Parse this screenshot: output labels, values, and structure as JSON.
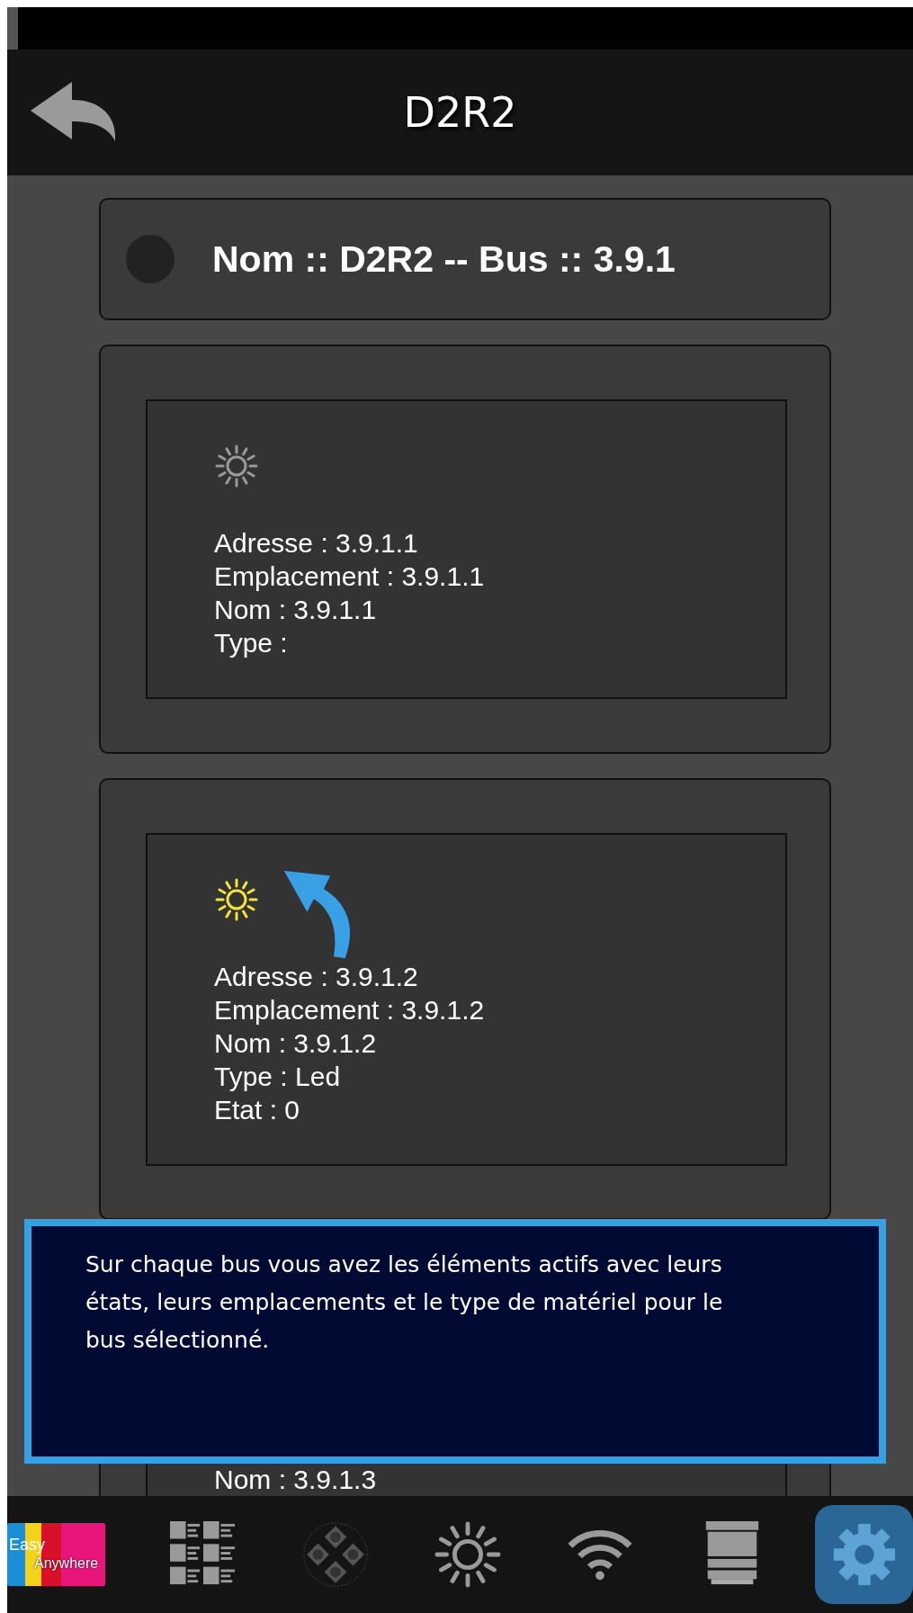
{
  "header": {
    "title": "D2R2"
  },
  "bus": {
    "label": "Nom :: D2R2 -- Bus :: 3.9.1"
  },
  "devices": [
    {
      "on": false,
      "lines": [
        "Adresse : 3.9.1.1",
        "Emplacement : 3.9.1.1",
        "Nom : 3.9.1.1",
        "Type :"
      ]
    },
    {
      "on": true,
      "lines": [
        "Adresse : 3.9.1.2",
        "Emplacement : 3.9.1.2",
        "Nom : 3.9.1.2",
        "Type : Led",
        "Etat : 0"
      ]
    },
    {
      "lines": [
        "Nom : 3.9.1.3"
      ]
    }
  ],
  "tip": {
    "text": "Sur chaque bus vous avez les éléments actifs avec leurs états, leurs emplacements et le type de matériel pour le bus sélectionné."
  },
  "logo": {
    "words": [
      "Easy",
      "Anywhere"
    ]
  },
  "tabs": [
    {
      "kind": "grid",
      "selected": false
    },
    {
      "kind": "dpad",
      "selected": false
    },
    {
      "kind": "sun",
      "selected": false
    },
    {
      "kind": "wifi",
      "selected": false
    },
    {
      "kind": "blind",
      "selected": false
    },
    {
      "kind": "gear",
      "selected": true
    }
  ]
}
